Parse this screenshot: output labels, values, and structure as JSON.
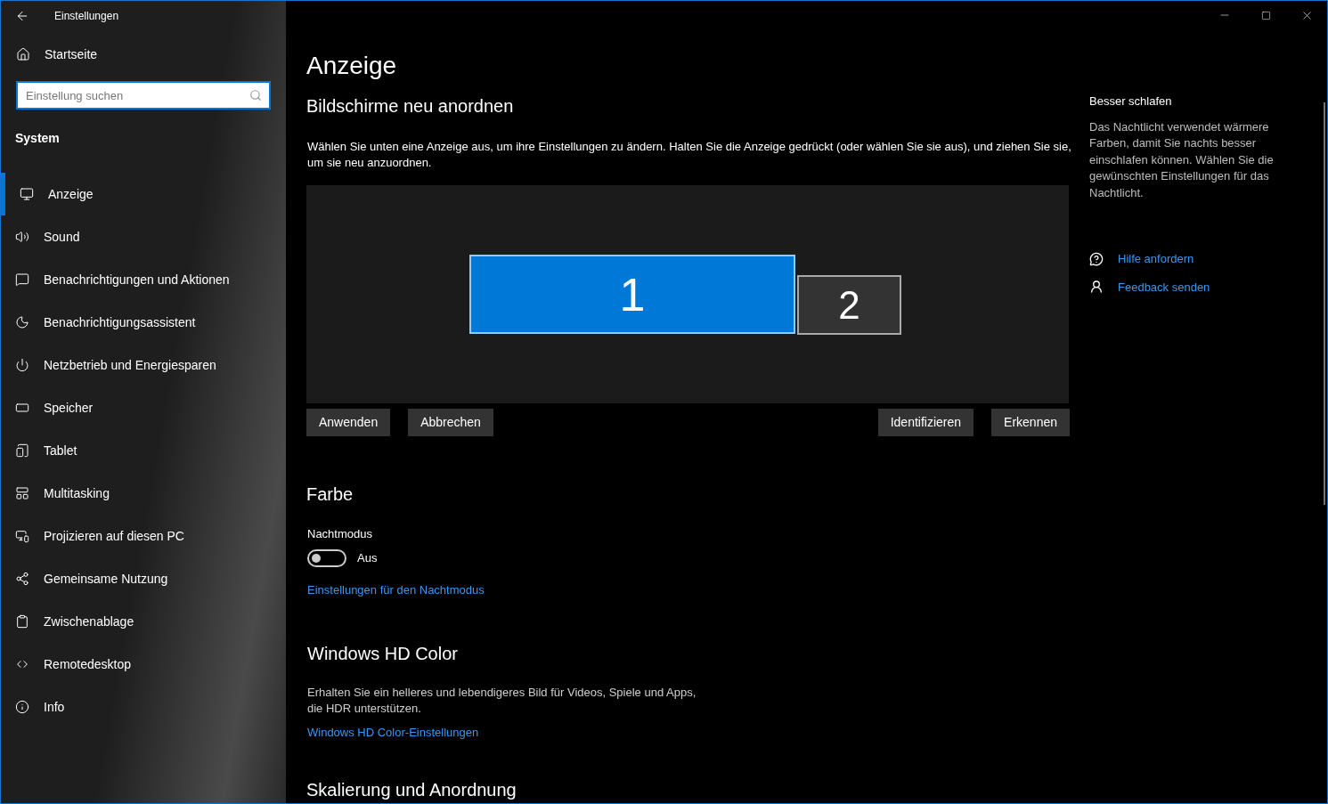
{
  "window": {
    "title": "Einstellungen"
  },
  "sidebar": {
    "home": "Startseite",
    "search": {
      "placeholder": "Einstellung suchen"
    },
    "section": "System",
    "items": [
      {
        "label": "Anzeige",
        "selected": true
      },
      {
        "label": "Sound",
        "selected": false
      },
      {
        "label": "Benachrichtigungen und Aktionen",
        "selected": false
      },
      {
        "label": "Benachrichtigungsassistent",
        "selected": false
      },
      {
        "label": "Netzbetrieb und Energiesparen",
        "selected": false
      },
      {
        "label": "Speicher",
        "selected": false
      },
      {
        "label": "Tablet",
        "selected": false
      },
      {
        "label": "Multitasking",
        "selected": false
      },
      {
        "label": "Projizieren auf diesen PC",
        "selected": false
      },
      {
        "label": "Gemeinsame Nutzung",
        "selected": false
      },
      {
        "label": "Zwischenablage",
        "selected": false
      },
      {
        "label": "Remotedesktop",
        "selected": false
      },
      {
        "label": "Info",
        "selected": false
      }
    ]
  },
  "page_title": "Anzeige",
  "arrange": {
    "heading": "Bildschirme neu anordnen",
    "description": "Wählen Sie unten eine Anzeige aus, um ihre Einstellungen zu ändern. Halten Sie die Anzeige gedrückt (oder wählen Sie sie aus), und ziehen Sie sie, um sie neu anzuordnen.",
    "monitors": [
      {
        "label": "1",
        "selected": true
      },
      {
        "label": "2",
        "selected": false
      }
    ],
    "buttons_left": [
      "Anwenden",
      "Abbrechen"
    ],
    "buttons_right": [
      "Identifizieren",
      "Erkennen"
    ]
  },
  "color": {
    "heading": "Farbe",
    "night_mode": {
      "label": "Nachtmodus",
      "on": false,
      "state_text": "Aus"
    },
    "link": "Einstellungen für den Nachtmodus"
  },
  "hdr": {
    "heading": "Windows HD Color",
    "description": "Erhalten Sie ein helleres und lebendigeres Bild für Videos, Spiele und Apps, die HDR unterstützen.",
    "link": "Windows HD Color-Einstellungen"
  },
  "scaling": {
    "heading": "Skalierung und Anordnung"
  },
  "aside": {
    "heading": "Besser schlafen",
    "text": "Das Nachtlicht verwendet wärmere Farben, damit Sie nachts besser einschlafen können. Wählen Sie die gewünschten Einstellungen für das Nachtlicht.",
    "links": [
      "Hilfe anfordern",
      "Feedback senden"
    ]
  }
}
